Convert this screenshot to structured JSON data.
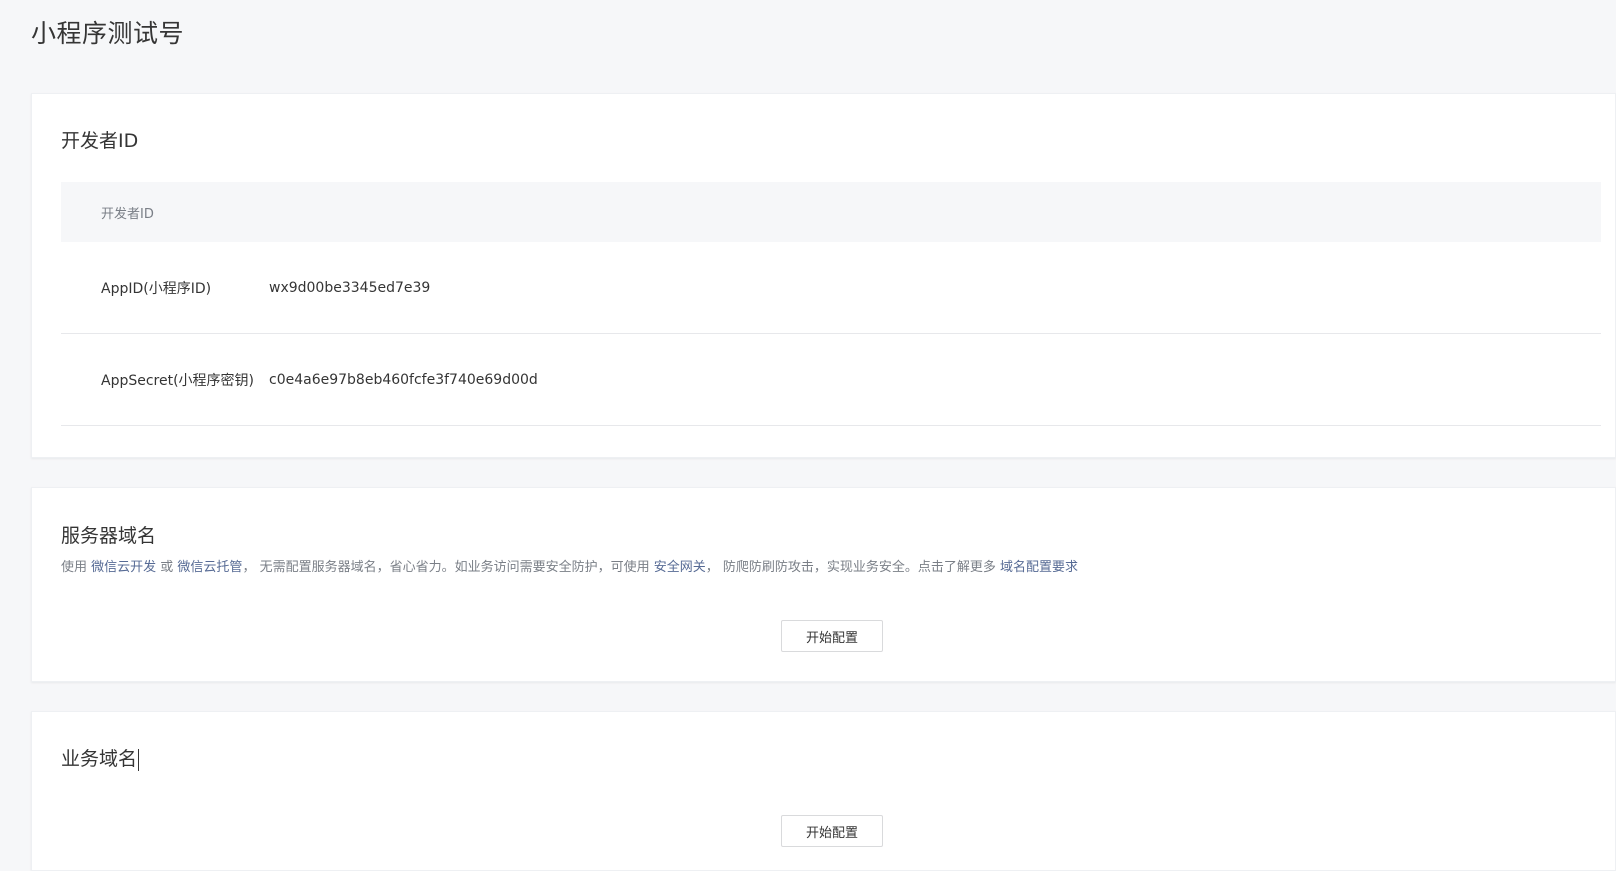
{
  "page": {
    "title": "小程序测试号"
  },
  "developer": {
    "title": "开发者ID",
    "table_header": "开发者ID",
    "rows": [
      {
        "label": "AppID(小程序ID)",
        "value": "wx9d00be3345ed7e39"
      },
      {
        "label": "AppSecret(小程序密钥)",
        "value": "c0e4a6e97b8eb460fcfe3f740e69d00d"
      }
    ]
  },
  "server_domain": {
    "title": "服务器域名",
    "desc_1": "使用 ",
    "link_1": "微信云开发",
    "desc_2": " 或 ",
    "link_2": "微信云托管",
    "desc_3": "， 无需配置服务器域名，省心省力。如业务访问需要安全防护，可使用 ",
    "link_3": "安全网关",
    "desc_4": "， 防爬防刷防攻击，实现业务安全。点击了解更多 ",
    "link_4": "域名配置要求",
    "button_label": "开始配置"
  },
  "business_domain": {
    "title": "业务域名",
    "button_label": "开始配置"
  },
  "colors": {
    "link": "#576b95",
    "background": "#f6f7f9",
    "text": "#353535",
    "muted": "#7a7f87"
  }
}
